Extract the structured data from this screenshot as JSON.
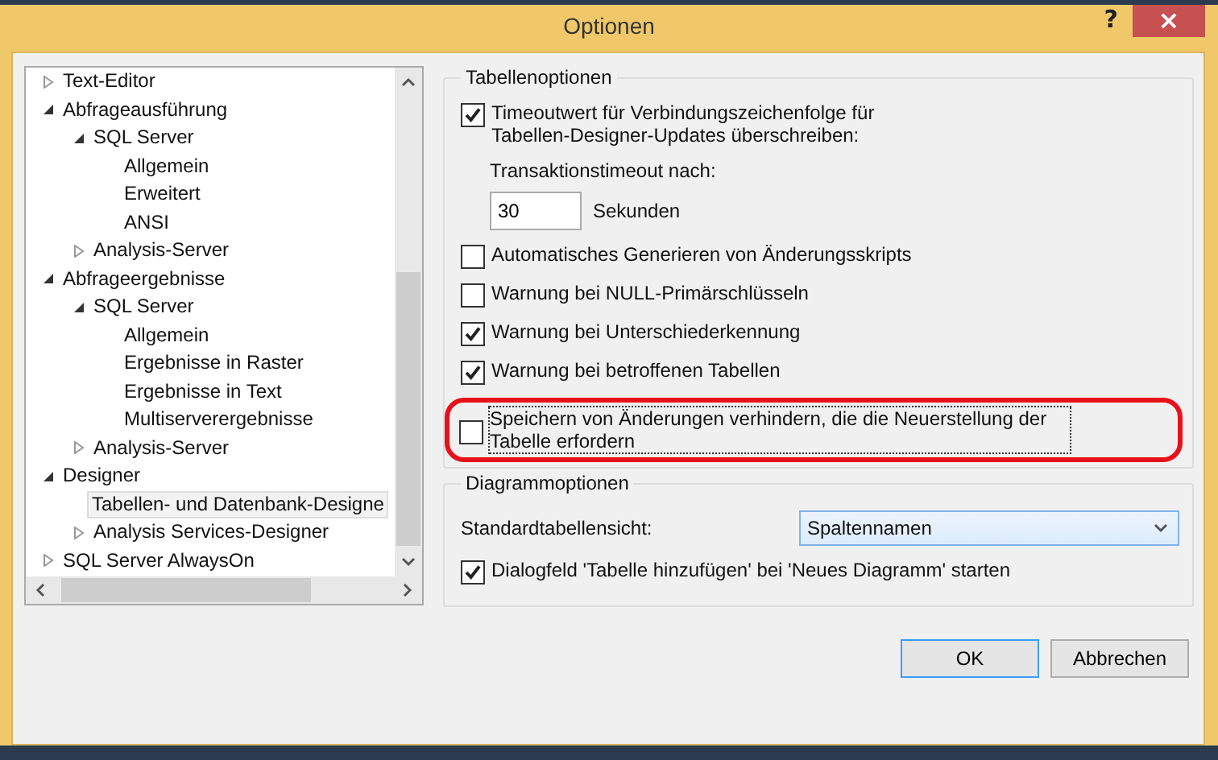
{
  "window": {
    "title": "Optionen",
    "help": "?",
    "close": "×"
  },
  "tree": [
    {
      "label": "Text-Editor",
      "expanded": false,
      "selected": false
    },
    {
      "label": "Abfrageausführung",
      "expanded": true,
      "selected": false,
      "children": [
        {
          "label": "SQL Server",
          "expanded": true,
          "selected": false,
          "children": [
            {
              "label": "Allgemein",
              "selected": false
            },
            {
              "label": "Erweitert",
              "selected": false
            },
            {
              "label": "ANSI",
              "selected": false
            }
          ]
        },
        {
          "label": "Analysis-Server",
          "expanded": false,
          "selected": false
        }
      ]
    },
    {
      "label": "Abfrageergebnisse",
      "expanded": true,
      "selected": false,
      "children": [
        {
          "label": "SQL Server",
          "expanded": true,
          "selected": false,
          "children": [
            {
              "label": "Allgemein",
              "selected": false
            },
            {
              "label": "Ergebnisse in Raster",
              "selected": false
            },
            {
              "label": "Ergebnisse in Text",
              "selected": false
            },
            {
              "label": "Multiserverergebnisse",
              "selected": false
            }
          ]
        },
        {
          "label": "Analysis-Server",
          "expanded": false,
          "selected": false
        }
      ]
    },
    {
      "label": "Designer",
      "expanded": true,
      "selected": false,
      "children": [
        {
          "label": "Tabellen- und Datenbank-Designe",
          "selected": true
        },
        {
          "label": "Analysis Services-Designer",
          "expanded": false,
          "selected": false
        }
      ]
    },
    {
      "label": "SQL Server AlwaysOn",
      "expanded": false,
      "selected": false
    }
  ],
  "table_options": {
    "title": "Tabellenoptionen",
    "items": [
      {
        "kind": "checkbox",
        "label": "Timeoutwert für Verbindungszeichenfolge für Tabellen-Designer-Updates überschreiben:",
        "checked": true,
        "highlighted": false
      },
      {
        "kind": "number",
        "label": "Transaktionstimeout nach:",
        "value": "30",
        "unit": "Sekunden"
      },
      {
        "kind": "checkbox",
        "label": "Automatisches Generieren von Änderungsskripts",
        "checked": false,
        "highlighted": false
      },
      {
        "kind": "checkbox",
        "label": "Warnung bei NULL-Primärschlüsseln",
        "checked": false,
        "highlighted": false
      },
      {
        "kind": "checkbox",
        "label": "Warnung bei Unterschiederkennung",
        "checked": true,
        "highlighted": false
      },
      {
        "kind": "checkbox",
        "label": "Warnung bei betroffenen Tabellen",
        "checked": true,
        "highlighted": false
      },
      {
        "kind": "checkbox",
        "label": "Speichern von Änderungen verhindern, die die Neuerstellung der Tabelle erfordern",
        "checked": false,
        "highlighted": true
      }
    ]
  },
  "diagram_options": {
    "title": "Diagrammoptionen",
    "view_label": "Standardtabellensicht:",
    "view_value": "Spaltennamen",
    "items": [
      {
        "kind": "checkbox",
        "label": "Dialogfeld 'Tabelle hinzufügen'  bei 'Neues Diagramm' starten",
        "checked": true
      }
    ]
  },
  "buttons": [
    {
      "label": "OK",
      "default": true
    },
    {
      "label": "Abbrechen",
      "default": false
    }
  ]
}
